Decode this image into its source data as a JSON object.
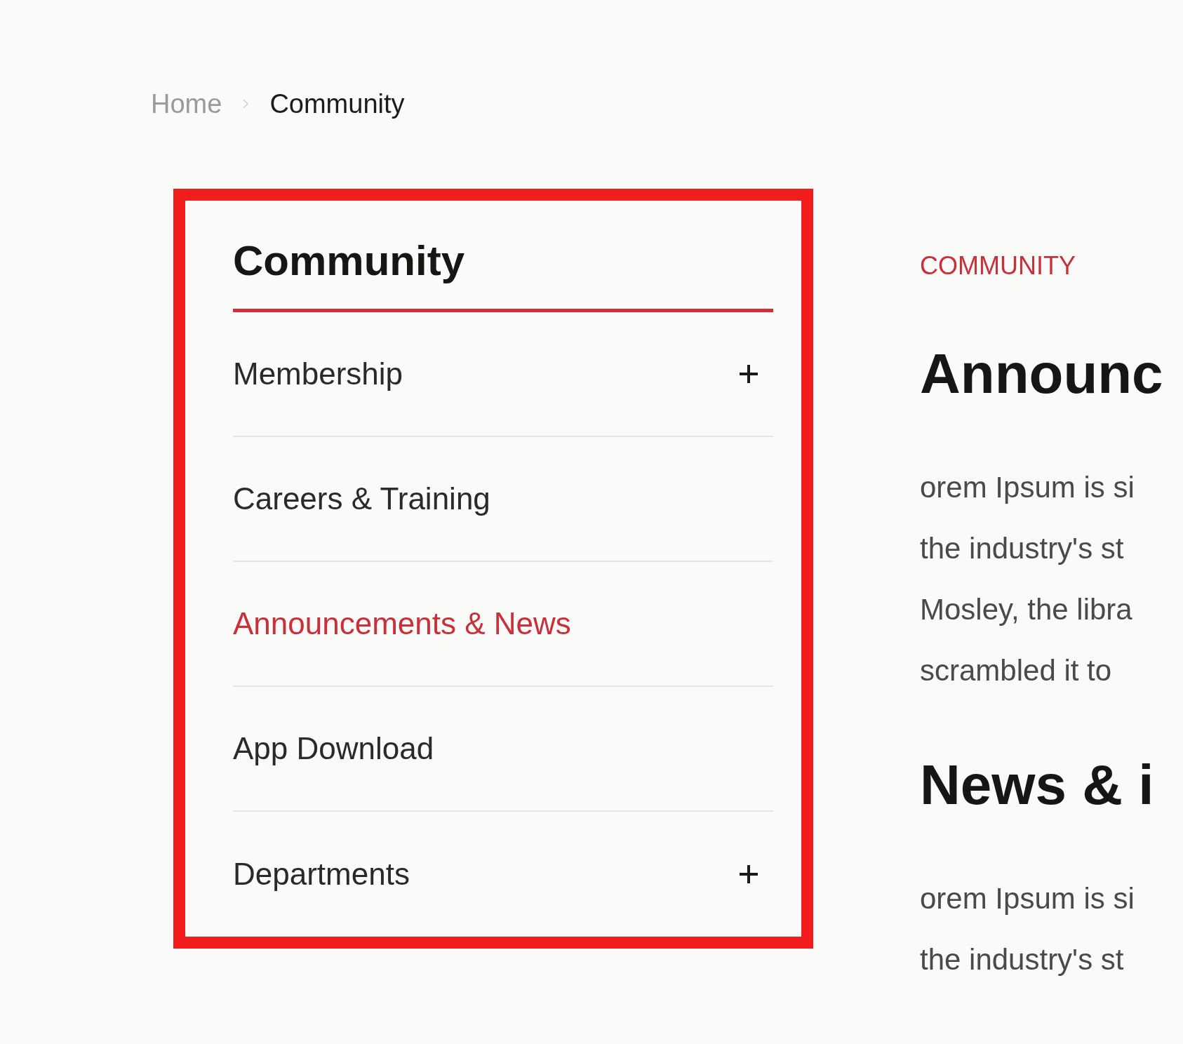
{
  "breadcrumb": [
    {
      "label": "Home",
      "current": false
    },
    {
      "label": "Community",
      "current": true
    }
  ],
  "sidebar": {
    "title": "Community",
    "items": [
      {
        "label": "Membership",
        "selected": false,
        "expandable": true
      },
      {
        "label": "Careers & Training",
        "selected": false,
        "expandable": false
      },
      {
        "label": "Announcements & News",
        "selected": true,
        "expandable": false
      },
      {
        "label": "App Download",
        "selected": false,
        "expandable": false
      },
      {
        "label": "Departments",
        "selected": false,
        "expandable": true
      }
    ]
  },
  "content": {
    "eyebrow": "COMMUNITY",
    "sections": [
      {
        "heading": "Announc",
        "lines": [
          "orem Ipsum is si",
          "the industry's st",
          "Mosley, the libra",
          "scrambled it to"
        ]
      },
      {
        "heading": "News & i",
        "lines": [
          "orem Ipsum is si",
          "the industry's st"
        ]
      }
    ]
  }
}
